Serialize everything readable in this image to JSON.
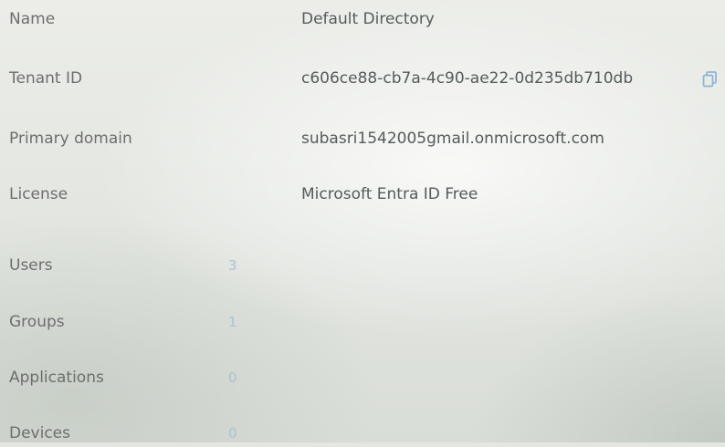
{
  "overview": {
    "name": {
      "label": "Name",
      "value": "Default Directory"
    },
    "tenant_id": {
      "label": "Tenant ID",
      "value": "c606ce88-cb7a-4c90-ae22-0d235db710db",
      "copy_icon": "copy-icon"
    },
    "primary_domain": {
      "label": "Primary domain",
      "value": "subasri1542005gmail.onmicrosoft.com"
    },
    "license": {
      "label": "License",
      "value": "Microsoft Entra ID Free"
    }
  },
  "stats": [
    {
      "label": "Users",
      "value": "3"
    },
    {
      "label": "Groups",
      "value": "1"
    },
    {
      "label": "Applications",
      "value": "0"
    },
    {
      "label": "Devices",
      "value": "0"
    }
  ],
  "colors": {
    "label_text": "#6e6e6e",
    "value_text": "#555b5b",
    "count_link": "#a9c2d6",
    "icon_accent": "#8fb3d6"
  }
}
